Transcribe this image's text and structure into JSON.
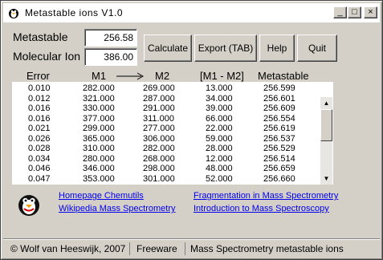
{
  "window": {
    "title": "Metastable  ions  V1.0",
    "minimize": "_",
    "maximize": "□",
    "close": "×"
  },
  "form": {
    "metastable_label": "Metastable",
    "metastable_value": "256.58",
    "molecular_ion_label": "Molecular Ion",
    "molecular_ion_value": "386.00"
  },
  "toolbar": {
    "calculate": "Calculate",
    "export": "Export (TAB)",
    "help": "Help",
    "quit": "Quit"
  },
  "table": {
    "headers": [
      "Error",
      "M1",
      "M2",
      "[M1 - M2]",
      "Metastable"
    ],
    "rows": [
      [
        "0.010",
        "282.000",
        "269.000",
        "13.000",
        "256.599"
      ],
      [
        "0.012",
        "321.000",
        "287.000",
        "34.000",
        "256.601"
      ],
      [
        "0.016",
        "330.000",
        "291.000",
        "39.000",
        "256.609"
      ],
      [
        "0.016",
        "377.000",
        "311.000",
        "66.000",
        "256.554"
      ],
      [
        "0.021",
        "299.000",
        "277.000",
        "22.000",
        "256.619"
      ],
      [
        "0.026",
        "365.000",
        "306.000",
        "59.000",
        "256.537"
      ],
      [
        "0.028",
        "310.000",
        "282.000",
        "28.000",
        "256.529"
      ],
      [
        "0.034",
        "280.000",
        "268.000",
        "12.000",
        "256.514"
      ],
      [
        "0.046",
        "346.000",
        "298.000",
        "48.000",
        "256.659"
      ],
      [
        "0.047",
        "353.000",
        "301.000",
        "52.000",
        "256.660"
      ]
    ]
  },
  "links": {
    "homepage": "Homepage Chemutils",
    "wikipedia": "Wikipedia Mass Spectrometry",
    "fragmentation": "Fragmentation in Mass Spectrometry",
    "introduction": "Introduction to Mass Spectroscopy"
  },
  "status": {
    "copyright": "© Wolf van Heeswijk, 2007",
    "license": "Freeware",
    "description": "Mass Spectrometry metastable ions"
  },
  "icons": {
    "app": "penguin-icon",
    "mascot": "penguin-mascot-icon",
    "arrow": "right-arrow-icon"
  }
}
